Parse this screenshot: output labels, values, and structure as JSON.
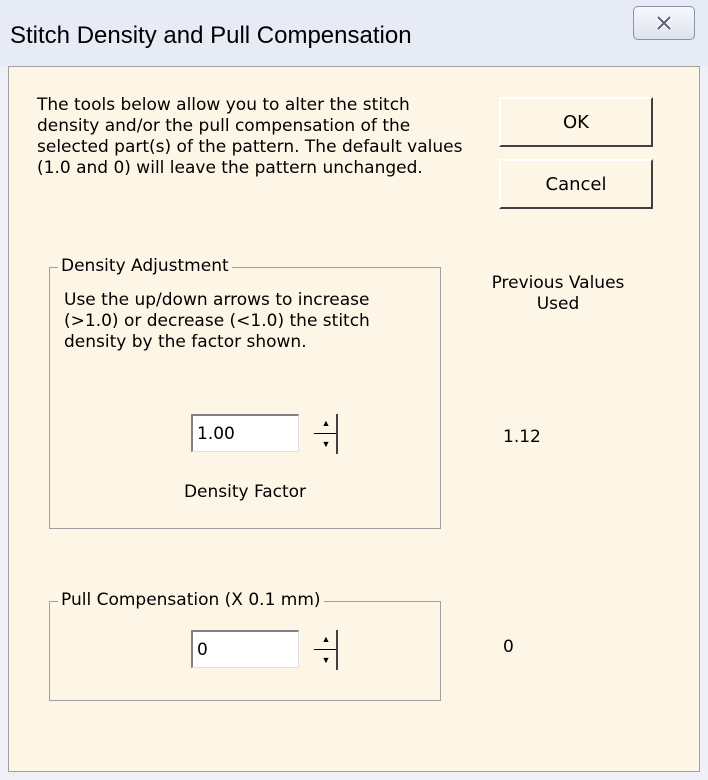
{
  "window": {
    "title": "Stitch Density and Pull Compensation"
  },
  "intro_text": "The tools below allow you to alter the stitch density and/or the pull compensation of the selected part(s) of the pattern. The default values (1.0 and 0) will leave the pattern unchanged.",
  "buttons": {
    "ok": "OK",
    "cancel": "Cancel"
  },
  "density": {
    "group_label": "Density Adjustment",
    "instructions": "Use the up/down arrows to increase (>1.0) or decrease (<1.0)  the stitch density by the factor shown.",
    "value": "1.00",
    "caption": "Density Factor"
  },
  "pull": {
    "group_label": "Pull Compensation (X 0.1 mm)",
    "value": "0"
  },
  "previous": {
    "heading": "Previous Values Used",
    "density_value": "1.12",
    "pull_value": "0"
  },
  "icons": {
    "close": "close-x-icon",
    "spin_up": "up-arrow-icon",
    "spin_down": "down-arrow-icon"
  },
  "colors": {
    "dialog_background": "#fdf5e6",
    "titlebar": "#e6ebf5"
  }
}
